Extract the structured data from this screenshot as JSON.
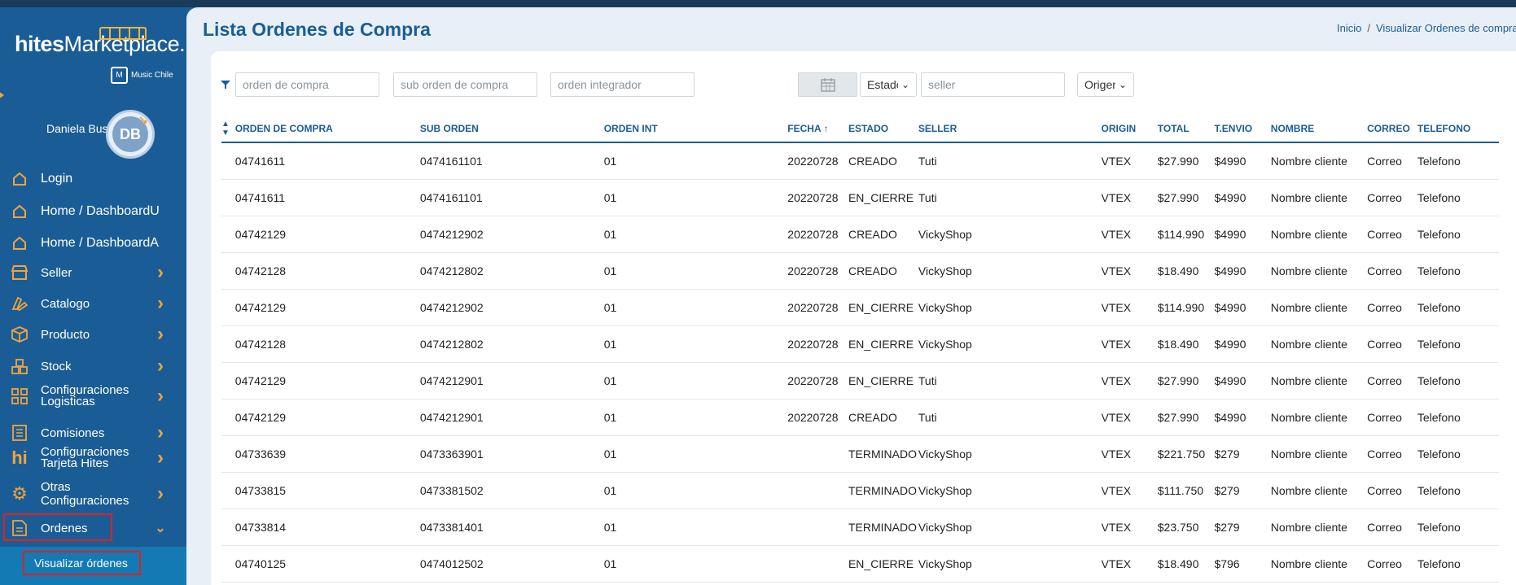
{
  "sidebar": {
    "logo": {
      "bold": "hites",
      "rest": "Marketplace."
    },
    "badge": {
      "icon_text": "M",
      "label": "Music Chile"
    },
    "user": {
      "name": "Daniela Bustos",
      "initials": "DB"
    },
    "items": [
      {
        "label": "Login",
        "icon": "home-icon",
        "has_chevron": false
      },
      {
        "label": "Home / DashboardU",
        "icon": "home-icon",
        "has_chevron": false
      },
      {
        "label": "Home / DashboardA",
        "icon": "home-icon",
        "has_chevron": false
      },
      {
        "label": "Seller",
        "icon": "store-icon",
        "has_chevron": true
      },
      {
        "label": "Catalogo",
        "icon": "swatch-icon",
        "has_chevron": true
      },
      {
        "label": "Producto",
        "icon": "box-icon",
        "has_chevron": true
      },
      {
        "label": "Stock",
        "icon": "boxes-icon",
        "has_chevron": true
      },
      {
        "label": "Configuraciones Logisticas",
        "icon": "grid-icon",
        "has_chevron": true
      },
      {
        "label": "Comisiones",
        "icon": "ledger-icon",
        "has_chevron": true
      },
      {
        "label": "Configuraciones Tarjeta Hites",
        "icon": "hi-icon",
        "has_chevron": true
      },
      {
        "label": "Otras Configuraciones",
        "icon": "gear-icon",
        "has_chevron": true
      },
      {
        "label": "Ordenes",
        "icon": "document-icon",
        "has_chevron": true,
        "expanded": true
      }
    ],
    "submenu": {
      "label": "Visualizar órdenes"
    }
  },
  "header": {
    "title": "Lista Ordenes de Compra",
    "breadcrumb": [
      "Inicio",
      "Visualizar Ordenes de compra"
    ]
  },
  "filters": {
    "orden_compra_placeholder": "orden de compra",
    "sub_orden_placeholder": "sub orden de compra",
    "orden_integrador_placeholder": "orden integrador",
    "estado_value": "Estado",
    "seller_placeholder": "seller",
    "origin_value": "Origen"
  },
  "table": {
    "columns": [
      "ORDEN DE COMPRA",
      "SUB ORDEN",
      "ORDEN INT",
      "FECHA",
      "ESTADO",
      "SELLER",
      "ORIGIN",
      "TOTAL",
      "T.ENVIO",
      "NOMBRE",
      "CORREO",
      "TELEFONO"
    ],
    "rows": [
      [
        "04741611",
        "0474161101",
        "01",
        "20220728",
        "CREADO",
        "Tuti",
        "VTEX",
        "$27.990",
        "$4990",
        "Nombre cliente",
        "Correo",
        "Telefono"
      ],
      [
        "04741611",
        "0474161101",
        "01",
        "20220728",
        "EN_CIERRE",
        "Tuti",
        "VTEX",
        "$27.990",
        "$4990",
        "Nombre cliente",
        "Correo",
        "Telefono"
      ],
      [
        "04742129",
        "0474212902",
        "01",
        "20220728",
        "CREADO",
        "VickyShop",
        "VTEX",
        "$114.990",
        "$4990",
        "Nombre cliente",
        "Correo",
        "Telefono"
      ],
      [
        "04742128",
        "0474212802",
        "01",
        "20220728",
        "CREADO",
        "VickyShop",
        "VTEX",
        "$18.490",
        "$4990",
        "Nombre cliente",
        "Correo",
        "Telefono"
      ],
      [
        "04742129",
        "0474212902",
        "01",
        "20220728",
        "EN_CIERRE",
        "VickyShop",
        "VTEX",
        "$114.990",
        "$4990",
        "Nombre cliente",
        "Correo",
        "Telefono"
      ],
      [
        "04742128",
        "0474212802",
        "01",
        "20220728",
        "EN_CIERRE",
        "VickyShop",
        "VTEX",
        "$18.490",
        "$4990",
        "Nombre cliente",
        "Correo",
        "Telefono"
      ],
      [
        "04742129",
        "0474212901",
        "01",
        "20220728",
        "EN_CIERRE",
        "Tuti",
        "VTEX",
        "$27.990",
        "$4990",
        "Nombre cliente",
        "Correo",
        "Telefono"
      ],
      [
        "04742129",
        "0474212901",
        "01",
        "20220728",
        "CREADO",
        "Tuti",
        "VTEX",
        "$27.990",
        "$4990",
        "Nombre cliente",
        "Correo",
        "Telefono"
      ],
      [
        "04733639",
        "0473363901",
        "01",
        "",
        "TERMINADO",
        "VickyShop",
        "VTEX",
        "$221.750",
        "$279",
        "Nombre cliente",
        "Correo",
        "Telefono"
      ],
      [
        "04733815",
        "0473381502",
        "01",
        "",
        "TERMINADO",
        "VickyShop",
        "VTEX",
        "$111.750",
        "$279",
        "Nombre cliente",
        "Correo",
        "Telefono"
      ],
      [
        "04733814",
        "0473381401",
        "01",
        "",
        "TERMINADO",
        "VickyShop",
        "VTEX",
        "$23.750",
        "$279",
        "Nombre cliente",
        "Correo",
        "Telefono"
      ],
      [
        "04740125",
        "0474012502",
        "01",
        "",
        "EN_CIERRE",
        "VickyShop",
        "VTEX",
        "$18.490",
        "$796",
        "Nombre cliente",
        "Correo",
        "Telefono"
      ]
    ]
  },
  "colors": {
    "primary": "#1a5d96",
    "accent": "#f2a33d",
    "highlight": "#e02020"
  }
}
